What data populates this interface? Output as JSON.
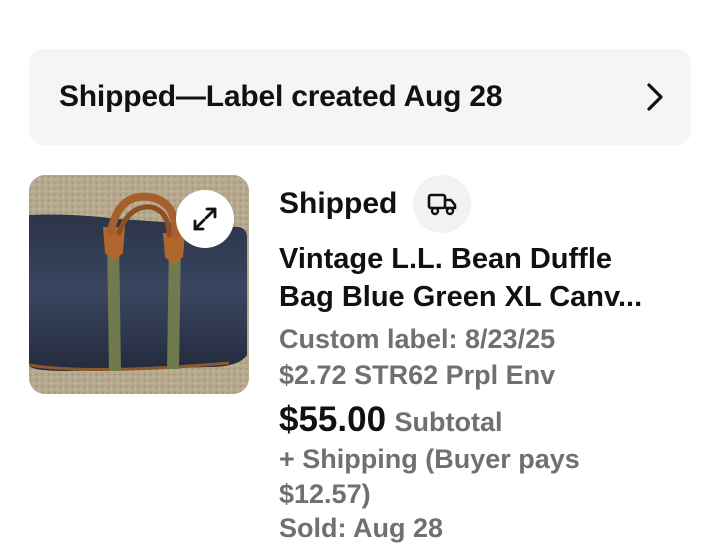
{
  "status_banner": {
    "text": "Shipped—Label created Aug 28",
    "chevron_icon": "chevron-right-icon"
  },
  "item": {
    "image_alt": "duffle bag photo",
    "expand_icon": "expand-arrows-icon",
    "status": "Shipped",
    "status_icon": "truck-icon",
    "title_line_1": "Vintage L.L. Bean Duffle",
    "title_line_2": "Bag Blue Green XL Canv...",
    "custom_label": "Custom label: 8/23/25",
    "shipping_note": "$2.72 STR62 Prpl Env",
    "price": "$55.00",
    "price_label": "Subtotal",
    "shipping_line_1": "+ Shipping (Buyer pays",
    "shipping_line_2": "$12.57)",
    "sold_date": "Sold: Aug 28"
  },
  "colors": {
    "banner_bg": "#f5f5f5",
    "primary_text": "#111111",
    "secondary_text": "#707070"
  }
}
